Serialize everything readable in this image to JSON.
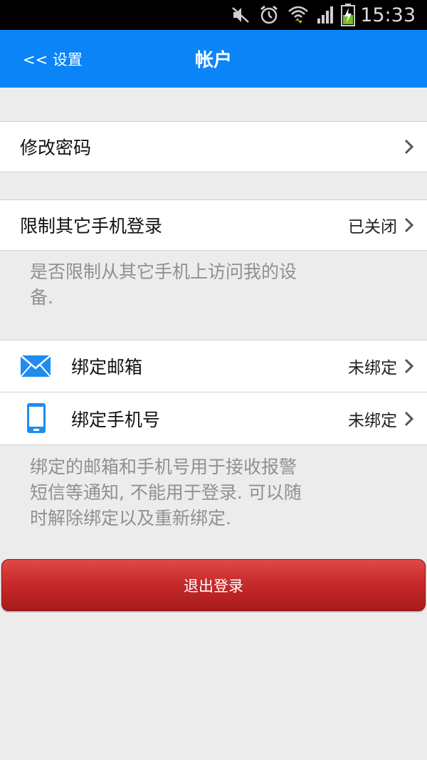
{
  "status_bar": {
    "time": "15:33",
    "icons": [
      "mute-icon",
      "alarm-icon",
      "wifi-icon",
      "signal-icon",
      "battery-charging-icon"
    ]
  },
  "nav": {
    "back_label": "<< 设置",
    "title": "帐户"
  },
  "rows": {
    "change_password": {
      "label": "修改密码"
    },
    "restrict_login": {
      "label": "限制其它手机登录",
      "value": "已关闭"
    },
    "restrict_desc": [
      "是否限制从其它手机上访问我的设",
      "备."
    ],
    "bind_email": {
      "label": "绑定邮箱",
      "value": "未绑定",
      "icon": "mail-icon"
    },
    "bind_phone": {
      "label": "绑定手机号",
      "value": "未绑定",
      "icon": "phone-icon"
    },
    "bind_desc": [
      "绑定的邮箱和手机号用于接收报警",
      "短信等通知, 不能用于登录. 可以随",
      "时解除绑定以及重新绑定."
    ]
  },
  "logout_label": "退出登录",
  "colors": {
    "nav_bg": "#0a84f7",
    "icon_blue": "#1f8cf0",
    "logout_red": "#c82b2b",
    "page_bg": "#ececec"
  }
}
